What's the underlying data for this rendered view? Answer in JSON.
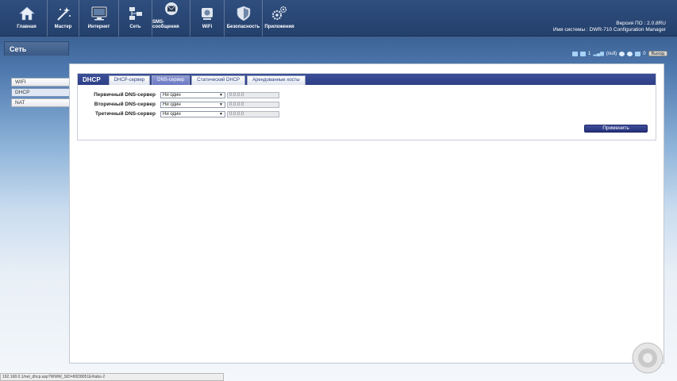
{
  "nav": {
    "items": [
      {
        "label": "Главная",
        "icon": "home-icon"
      },
      {
        "label": "Мастер",
        "icon": "wand-icon"
      },
      {
        "label": "Интернет",
        "icon": "monitor-icon"
      },
      {
        "label": "Сеть",
        "icon": "network-icon"
      },
      {
        "label": "SMS-сообщения",
        "icon": "envelope-icon"
      },
      {
        "label": "WiFi",
        "icon": "wifi-router-icon"
      },
      {
        "label": "Безопасность",
        "icon": "shield-icon"
      },
      {
        "label": "Приложения",
        "icon": "gears-icon"
      }
    ]
  },
  "system": {
    "firmware_line": "Версия ПО :  2.0.8RU",
    "name_line": "Имя системы :  DWR-710 Configuration Manager"
  },
  "status": {
    "sms_count": "1",
    "signal_text": "(null)",
    "msg_count": "0",
    "logout_label": "Выход"
  },
  "sidebar": {
    "title": "Сеть",
    "items": [
      {
        "label": "WIFI"
      },
      {
        "label": "DHCP"
      },
      {
        "label": "NAT"
      }
    ]
  },
  "panel": {
    "title": "DHCP",
    "tabs": [
      {
        "label": "DHCP-сервер"
      },
      {
        "label": "DNS-сервер"
      },
      {
        "label": "Статический DHCP"
      },
      {
        "label": "Арендованные хосты"
      }
    ],
    "rows": [
      {
        "label": "Первичный DNS-сервер",
        "select_value": "Ни один",
        "ip": "0.0.0.0"
      },
      {
        "label": "Вторичный DNS-сервер",
        "select_value": "Ни один",
        "ip": "0.0.0.0"
      },
      {
        "label": "Третичный DNS-сервер",
        "select_value": "Ни один",
        "ip": "0.0.0.0"
      }
    ],
    "apply_label": "Применить"
  },
  "browser": {
    "status_url": "192.168.0.1/net_dhcp.asp?WWW_SID=80D8051E#tabs-2"
  },
  "colors": {
    "topbar": "#24406c",
    "panel_header": "#2e3f86",
    "active_tab": "#6c79c4",
    "apply_button": "#25307a"
  }
}
